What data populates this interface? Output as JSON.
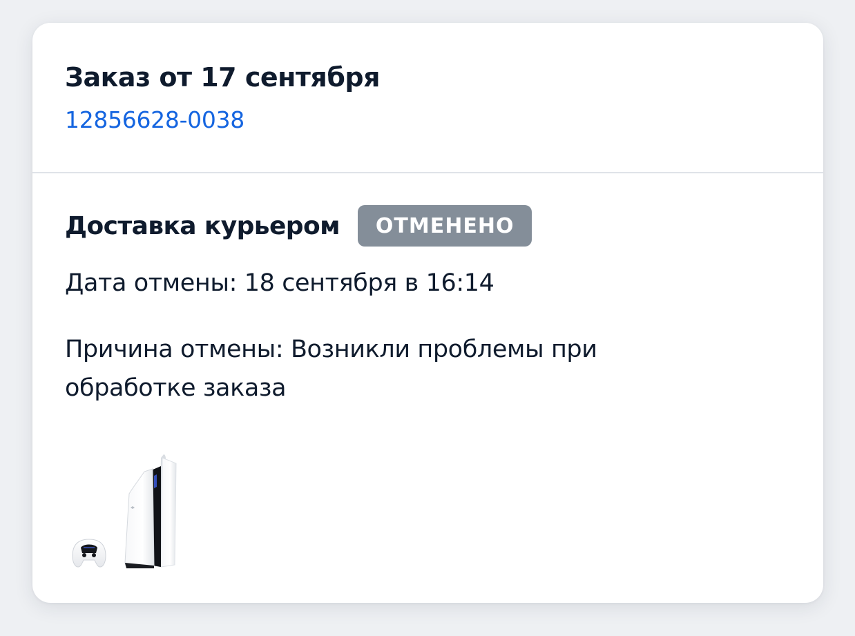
{
  "order": {
    "title": "Заказ от 17 сентября",
    "number": "12856628-0038"
  },
  "delivery": {
    "method": "Доставка курьером",
    "status": "ОТМЕНЕНО",
    "status_color": "#848e99",
    "cancel_date": "Дата отмены: 18 сентября в 16:14",
    "cancel_reason": "Причина отмены: Возникли проблемы при обработке заказа"
  },
  "product": {
    "icon": "game-console-icon"
  },
  "colors": {
    "link": "#1565e0",
    "text": "#0f1b2d",
    "divider": "#dfe3e8"
  }
}
